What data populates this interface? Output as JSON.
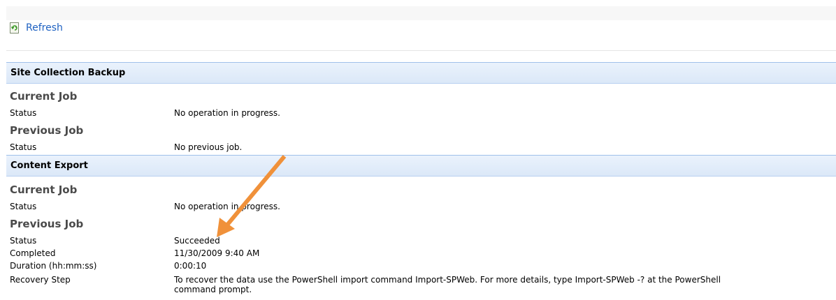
{
  "toolbar": {
    "refresh_label": "Refresh"
  },
  "sections": [
    {
      "header": "Site Collection Backup",
      "current_job_title": "Current Job",
      "current_status_label": "Status",
      "current_status_value": "No operation in progress.",
      "previous_job_title": "Previous Job",
      "previous_status_label": "Status",
      "previous_status_value": "No previous job."
    },
    {
      "header": "Content Export",
      "current_job_title": "Current Job",
      "current_status_label": "Status",
      "current_status_value": "No operation in progress.",
      "previous_job_title": "Previous Job",
      "rows": [
        {
          "label": "Status",
          "value": "Succeeded"
        },
        {
          "label": "Completed",
          "value": "11/30/2009 9:40 AM"
        },
        {
          "label": "Duration (hh:mm:ss)",
          "value": "0:00:10"
        },
        {
          "label": "Recovery Step",
          "value_line1": "To recover the data use the PowerShell import command Import-SPWeb. For more details, type Import-SPWeb -? at the PowerShell",
          "value_line2": "command prompt."
        }
      ]
    }
  ],
  "colors": {
    "link": "#1f62c2",
    "header_bg": "#dbe8f8",
    "header_border": "#9fc0ea",
    "arrow": "#f0913a"
  },
  "icons": {
    "refresh": "refresh-icon"
  }
}
